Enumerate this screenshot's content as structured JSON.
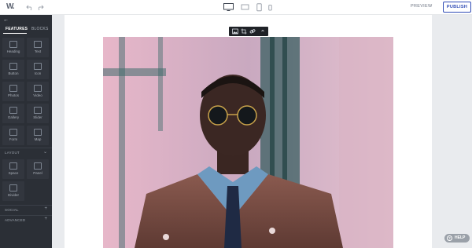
{
  "header": {
    "logo_text": "W.",
    "preview_label": "PREVIEW",
    "publish_label": "PUBLISH"
  },
  "sidebar": {
    "tabs": [
      {
        "label": "FEATURES",
        "active": true
      },
      {
        "label": "BLOCKS",
        "active": false
      }
    ],
    "feature_tiles": [
      {
        "label": "Heading",
        "icon": "heading-icon"
      },
      {
        "label": "Text",
        "icon": "text-icon"
      },
      {
        "label": "Button",
        "icon": "button-icon"
      },
      {
        "label": "Icon",
        "icon": "icon-icon"
      },
      {
        "label": "Photos",
        "icon": "photo-icon"
      },
      {
        "label": "Video",
        "icon": "video-icon"
      },
      {
        "label": "Gallery",
        "icon": "gallery-icon"
      },
      {
        "label": "Slider",
        "icon": "slider-icon"
      },
      {
        "label": "Form",
        "icon": "form-icon"
      },
      {
        "label": "Map",
        "icon": "map-icon"
      }
    ],
    "layout_section": {
      "title": "LAYOUT",
      "toggle": "⌄",
      "tiles": [
        {
          "label": "Space",
          "icon": "space-icon"
        },
        {
          "label": "Panel",
          "icon": "panel-icon"
        },
        {
          "label": "Divider",
          "icon": "divider-icon"
        }
      ]
    },
    "social_section": {
      "title": "SOCIAL",
      "toggle": "+"
    },
    "advanced_section": {
      "title": "ADVANCED",
      "toggle": "+"
    }
  },
  "image_toolbar": {
    "buttons": [
      "image-icon",
      "crop-icon",
      "link-icon",
      "more-icon"
    ]
  },
  "help": {
    "label": "HELP",
    "glyph": "?"
  },
  "colors": {
    "sidebar_bg": "#2b2f36",
    "accent": "#2f4bb5",
    "canvas_bg": "#e9ebee"
  }
}
